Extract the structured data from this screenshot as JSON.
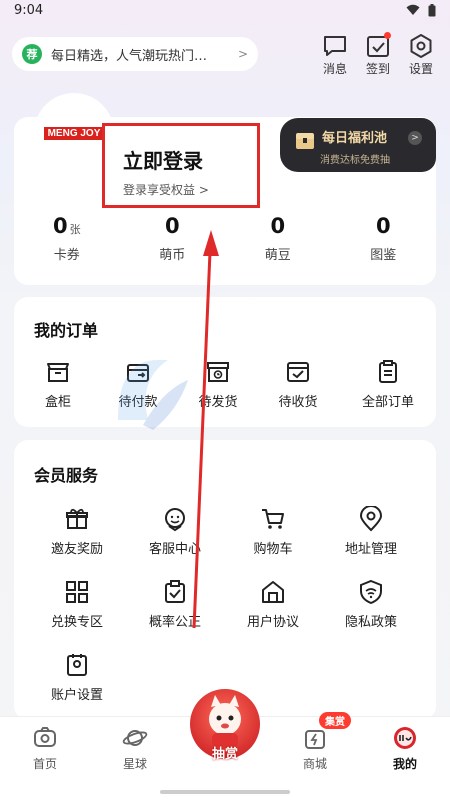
{
  "status_bar": {
    "time": "9:04"
  },
  "notice": {
    "badge": "荐",
    "text": "每日精选，人气潮玩热门…",
    "arrow": ">"
  },
  "top_actions": [
    {
      "label": "消息",
      "icon": "message-icon"
    },
    {
      "label": "签到",
      "icon": "checkin-icon",
      "dot": true
    },
    {
      "label": "设置",
      "icon": "gear-icon"
    }
  ],
  "profile": {
    "brand": "MENG JOY",
    "login_title": "立即登录",
    "login_sub": "登录享受权益 >",
    "welfare_title": "每日福利池",
    "welfare_sub": "消费达标免费抽",
    "welfare_go": ">",
    "stats": [
      {
        "value": "0",
        "unit": "张",
        "label": "卡券"
      },
      {
        "value": "0",
        "unit": "",
        "label": "萌币"
      },
      {
        "value": "0",
        "unit": "",
        "label": "萌豆"
      },
      {
        "value": "0",
        "unit": "",
        "label": "图鉴"
      }
    ]
  },
  "orders": {
    "title": "我的订单",
    "items": [
      {
        "label": "盒柜",
        "icon": "box-cabinet-icon"
      },
      {
        "label": "待付款",
        "icon": "wallet-icon"
      },
      {
        "label": "待发货",
        "icon": "clock-box-icon"
      },
      {
        "label": "待收货",
        "icon": "receive-check-icon"
      },
      {
        "label": "全部订单",
        "icon": "order-list-icon"
      }
    ]
  },
  "member": {
    "title": "会员服务",
    "items": [
      {
        "label": "邀友奖励",
        "icon": "gift-icon"
      },
      {
        "label": "客服中心",
        "icon": "customer-service-icon"
      },
      {
        "label": "购物车",
        "icon": "cart-icon"
      },
      {
        "label": "地址管理",
        "icon": "location-icon"
      },
      {
        "label": "兑换专区",
        "icon": "exchange-grid-icon"
      },
      {
        "label": "概率公正",
        "icon": "clipboard-check-icon"
      },
      {
        "label": "用户协议",
        "icon": "house-icon"
      },
      {
        "label": "隐私政策",
        "icon": "shield-wifi-icon"
      },
      {
        "label": "账户设置",
        "icon": "account-settings-icon"
      }
    ]
  },
  "bottom_nav": {
    "items": [
      {
        "label": "首页",
        "icon": "home-camera-icon"
      },
      {
        "label": "星球",
        "icon": "planet-icon"
      },
      {
        "label": "抽赏",
        "icon": "lottery-mascot-icon"
      },
      {
        "label": "商城",
        "icon": "mall-icon",
        "badge": "集赏"
      },
      {
        "label": "我的",
        "icon": "mine-icon",
        "active": true
      }
    ]
  },
  "colors": {
    "accent_red": "#e02a2a",
    "welfare_bg": "#2a2a2e",
    "welfare_gold": "#f3d9a6",
    "badge_green": "#27b35c"
  }
}
